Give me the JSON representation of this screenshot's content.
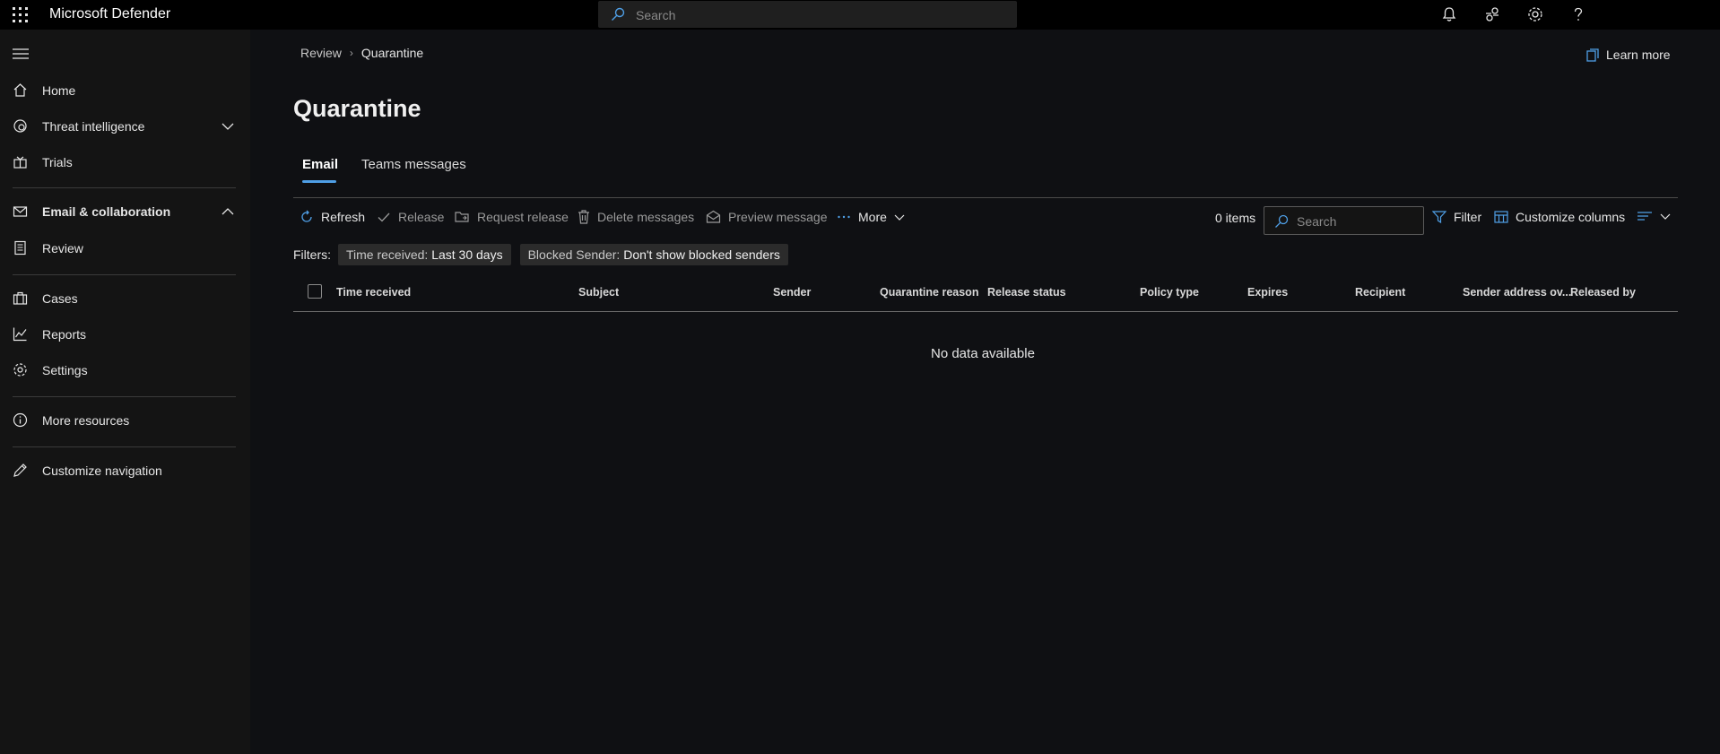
{
  "app": {
    "title": "Microsoft Defender"
  },
  "search": {
    "placeholder": "Search"
  },
  "sidebar": {
    "items": [
      {
        "label": "Home"
      },
      {
        "label": "Threat intelligence"
      },
      {
        "label": "Trials"
      },
      {
        "label": "Email & collaboration"
      },
      {
        "label": "Review"
      },
      {
        "label": "Cases"
      },
      {
        "label": "Reports"
      },
      {
        "label": "Settings"
      },
      {
        "label": "More resources"
      },
      {
        "label": "Customize navigation"
      }
    ]
  },
  "breadcrumb": {
    "parent": "Review",
    "current": "Quarantine"
  },
  "learn_more": "Learn more",
  "page": {
    "title": "Quarantine"
  },
  "tabs": [
    {
      "label": "Email"
    },
    {
      "label": "Teams messages"
    }
  ],
  "toolbar": {
    "refresh": "Refresh",
    "release": "Release",
    "request_release": "Request release",
    "delete_messages": "Delete messages",
    "preview_message": "Preview message",
    "more": "More",
    "items_count": "0 items",
    "search_placeholder": "Search",
    "filter": "Filter",
    "customize_columns": "Customize columns"
  },
  "filters": {
    "label": "Filters:",
    "chips": [
      {
        "key": "Time received:",
        "value": "Last 30 days"
      },
      {
        "key": "Blocked Sender:",
        "value": "Don't show blocked senders"
      }
    ]
  },
  "table": {
    "columns": [
      "Time received",
      "Subject",
      "Sender",
      "Quarantine reason",
      "Release status",
      "Policy type",
      "Expires",
      "Recipient",
      "Sender address ov...",
      "Released by"
    ],
    "empty_text": "No data available"
  },
  "colors": {
    "accent": "#4f9fe6",
    "background": "#0f1013",
    "sidebar": "#141414",
    "topbar": "#000000"
  }
}
